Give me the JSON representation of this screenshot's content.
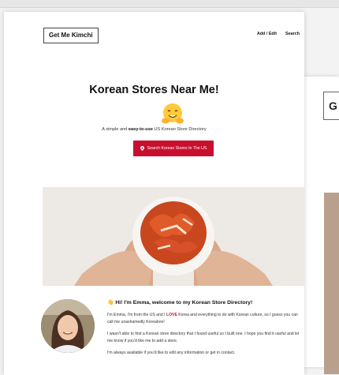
{
  "site": {
    "logo": "Get Me Kimchi"
  },
  "nav": {
    "items": [
      "Add / Edit",
      "Search"
    ]
  },
  "hero": {
    "title": "Korean Stores Near Me!",
    "tagline_pre": "A simple and ",
    "tagline_bold": "easy-to-use",
    "tagline_post": " US Korean Store Directory",
    "button": "Search Korean Stores In The US",
    "emoji": "hugging-face-emoji"
  },
  "intro": {
    "title": "👋 Hi! I'm Emma, welcome to my Korean Store Directory!",
    "p1_pre": "I'm Emma, I'm from the US and I ",
    "p1_love": "LOVE",
    "p1_post": " Korea and everything to do with Korean culture, so I guess you can call me unashamedly Koreaboo!",
    "p2": "I wasn't able to find a Korean store directory that I found useful so I built one. I hope you find it useful and let me know if you'd like me to add a store.",
    "p3": "I'm always available if you'd like to edit any information or get in contact."
  },
  "background_window": {
    "letter": "G"
  },
  "colors": {
    "accent": "#c8102e"
  }
}
